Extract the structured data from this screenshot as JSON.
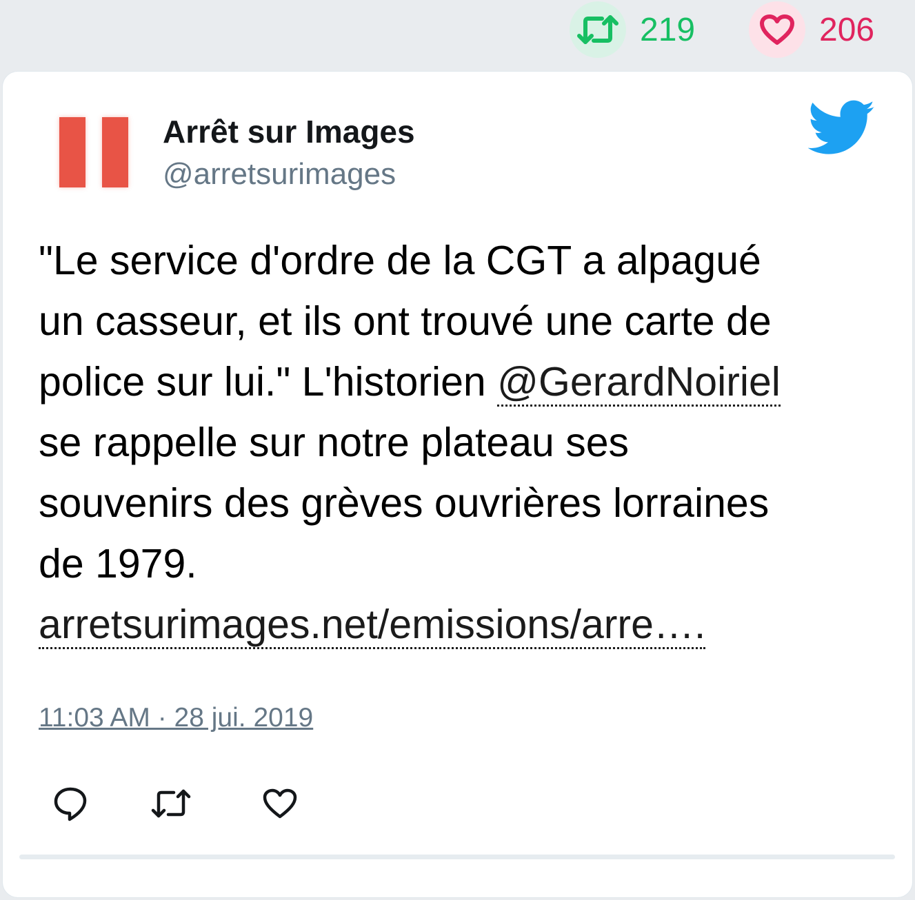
{
  "top_stats": {
    "retweets": "219",
    "likes": "206",
    "retweet_icon": "retweet-icon",
    "like_icon": "heart-icon",
    "retweet_color": "#17bf63",
    "like_color": "#e0245e"
  },
  "tweet": {
    "author_name": "Arrêt sur Images",
    "author_handle": "@arretsurimages",
    "text_lines": {
      "l1": "\"Le service d'ordre de la CGT a alpagué",
      "l2": "un casseur, et ils ont trouvé une carte de",
      "l3_prefix": "police sur lui.\" L'historien ",
      "mention": "@GerardNoiriel",
      "l4": "se rappelle sur notre plateau ses",
      "l5": "souvenirs des grèves ouvrières lorraines",
      "l6": "de 1979.",
      "link": "arretsurimages.net/emissions/arre…."
    },
    "timestamp": "11:03 AM · 28 jui. 2019",
    "brand_icon": "twitter-bird-icon",
    "brand_color": "#1da1f2",
    "avatar_color": "#e85446"
  },
  "actions": {
    "reply_icon": "reply-icon",
    "retweet_icon": "retweet-icon",
    "like_icon": "heart-icon"
  }
}
